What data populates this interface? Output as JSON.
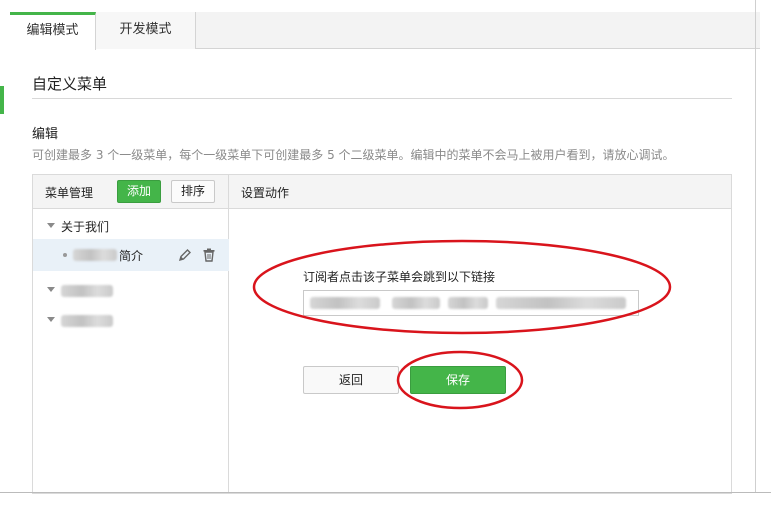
{
  "tabs": [
    {
      "label": "编辑模式",
      "active": true
    },
    {
      "label": "开发模式",
      "active": false
    }
  ],
  "page": {
    "title": "自定义菜单",
    "section_title": "编辑",
    "section_desc": "可创建最多 3 个一级菜单，每个一级菜单下可创建最多 5 个二级菜单。编辑中的菜单不会马上被用户看到，请放心调试。"
  },
  "menu_panel": {
    "header": "菜单管理",
    "add_label": "添加",
    "sort_label": "排序",
    "items": [
      {
        "label": "关于我们",
        "expanded": true
      },
      {
        "label_suffix": "简介",
        "selected": true
      },
      {
        "label": "",
        "expanded": true
      },
      {
        "label": "",
        "expanded": true
      }
    ]
  },
  "action_panel": {
    "header": "设置动作",
    "field_label": "订阅者点击该子菜单会跳到以下链接",
    "back_label": "返回",
    "save_label": "保存"
  },
  "colors": {
    "accent": "#44b549",
    "annotation": "#d9141c",
    "selected_row": "#e9f1f8"
  }
}
